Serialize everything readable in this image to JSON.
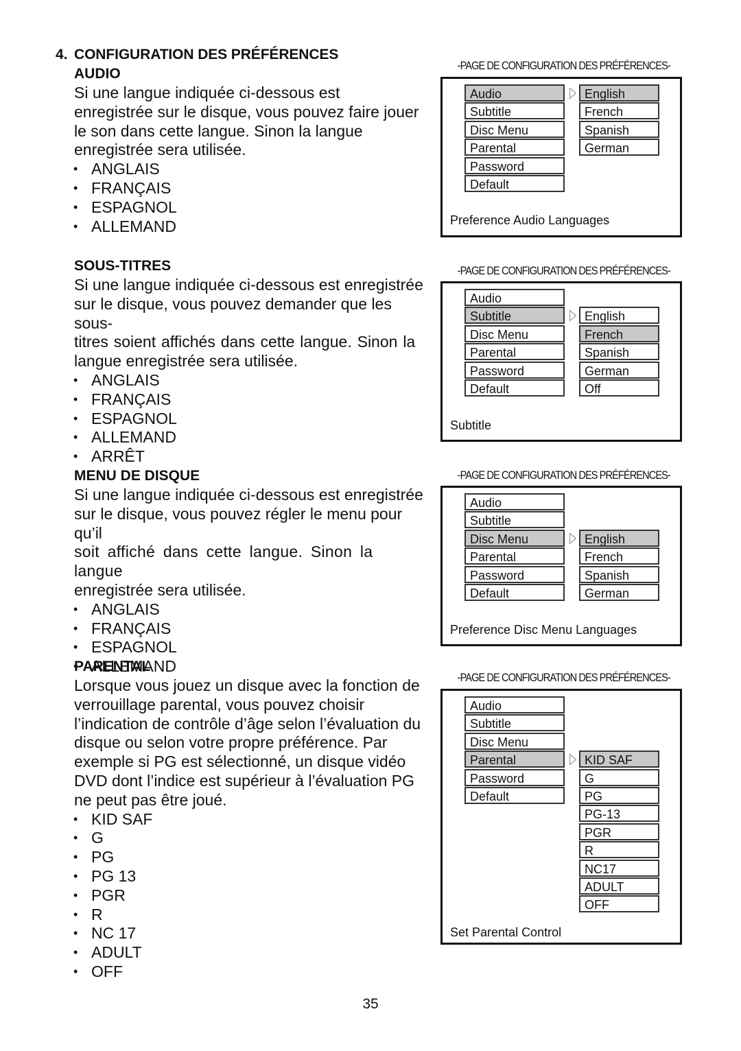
{
  "title": {
    "number": "4.",
    "text": "CONFIGURATION DES PRÉFÉRENCES"
  },
  "sections": {
    "audio": {
      "heading": "AUDIO",
      "body": "Si une langue indiquée ci-dessous est enregistrée sur le disque, vous pouvez faire jouer le son dans cette langue.  Sinon la langue enregistrée sera utilisée.",
      "lines": [
        "Si une langue indiquée ci-dessous est",
        "enregistrée sur le disque, vous pouvez faire jouer",
        "le son dans cette langue.  Sinon la langue",
        "enregistrée sera utilisée."
      ],
      "bullets": [
        "ANGLAIS",
        "FRANÇAIS",
        "ESPAGNOL",
        "ALLEMAND"
      ]
    },
    "subtitle": {
      "heading": "SOUS-TITRES",
      "lines": [
        "Si une langue indiquée ci-dessous est enregistrée",
        "sur le disque, vous pouvez demander que les sous-",
        "titres soient affichés dans cette langue. Sinon la",
        "langue enregistrée sera utilisée."
      ],
      "bullets": [
        "ANGLAIS",
        "FRANÇAIS",
        "ESPAGNOL",
        "ALLEMAND",
        "ARRÊT"
      ]
    },
    "disc_menu": {
      "heading": "MENU DE DISQUE",
      "lines": [
        "Si une langue indiquée ci-dessous est enregistrée",
        "sur le disque, vous pouvez régler le menu pour qu’il",
        "soit affiché dans cette langue. Sinon la langue",
        "enregistrée sera utilisée."
      ],
      "bullets": [
        "ANGLAIS",
        "FRANÇAIS",
        "ESPAGNOL",
        "ALLEMAND"
      ]
    },
    "parental": {
      "heading": "PARENTAL",
      "lines": [
        "Lorsque vous jouez un disque avec la fonction de",
        "verrouillage parental, vous pouvez choisir",
        "l’indication de contrôle d’âge selon l’évaluation du",
        "disque ou selon votre propre préférence.  Par",
        "exemple si PG est sélectionné, un disque vidéo",
        "DVD dont l’indice est supérieur à l’évaluation PG",
        "ne peut pas être joué."
      ],
      "bullets": [
        "KID SAF",
        "G",
        "PG",
        "PG 13",
        "PGR",
        "R",
        "NC 17",
        "ADULT",
        "OFF"
      ]
    }
  },
  "panels": [
    {
      "caption": "-PAGE DE CONFIGURATION DES PRÉFÉRENCES-",
      "menu": [
        "Audio",
        "Subtitle",
        "Disc Menu",
        "Parental",
        "Password",
        "Default"
      ],
      "selected_menu": 0,
      "options": [
        "English",
        "French",
        "Spanish",
        "German"
      ],
      "selected_option": 0,
      "footer": "Preference Audio Languages"
    },
    {
      "caption": "-PAGE DE CONFIGURATION DES PRÉFÉRENCES-",
      "menu": [
        "Audio",
        "Subtitle",
        "Disc Menu",
        "Parental",
        "Password",
        "Default"
      ],
      "selected_menu": 1,
      "options": [
        "English",
        "French",
        "Spanish",
        "German",
        "Off"
      ],
      "selected_option": 1,
      "footer": "Subtitle"
    },
    {
      "caption": "-PAGE DE CONFIGURATION DES PRÉFÉRENCES-",
      "menu": [
        "Audio",
        "Subtitle",
        "Disc Menu",
        "Parental",
        "Password",
        "Default"
      ],
      "selected_menu": 2,
      "options": [
        "English",
        "French",
        "Spanish",
        "German"
      ],
      "selected_option": 0,
      "footer": "Preference Disc Menu Languages"
    },
    {
      "caption": "-PAGE DE CONFIGURATION DES PRÉFÉRENCES-",
      "menu": [
        "Audio",
        "Subtitle",
        "Disc Menu",
        "Parental",
        "Password",
        "Default"
      ],
      "selected_menu": 3,
      "options": [
        "KID SAF",
        "G",
        "PG",
        "PG-13",
        "PGR",
        "R",
        "NC17",
        "ADULT",
        "OFF"
      ],
      "selected_option": 0,
      "footer": "Set Parental Control"
    }
  ],
  "colors": {
    "highlight": "#c9c9c9",
    "border": "#111111",
    "arrow": "#999999"
  },
  "page_number": "35"
}
